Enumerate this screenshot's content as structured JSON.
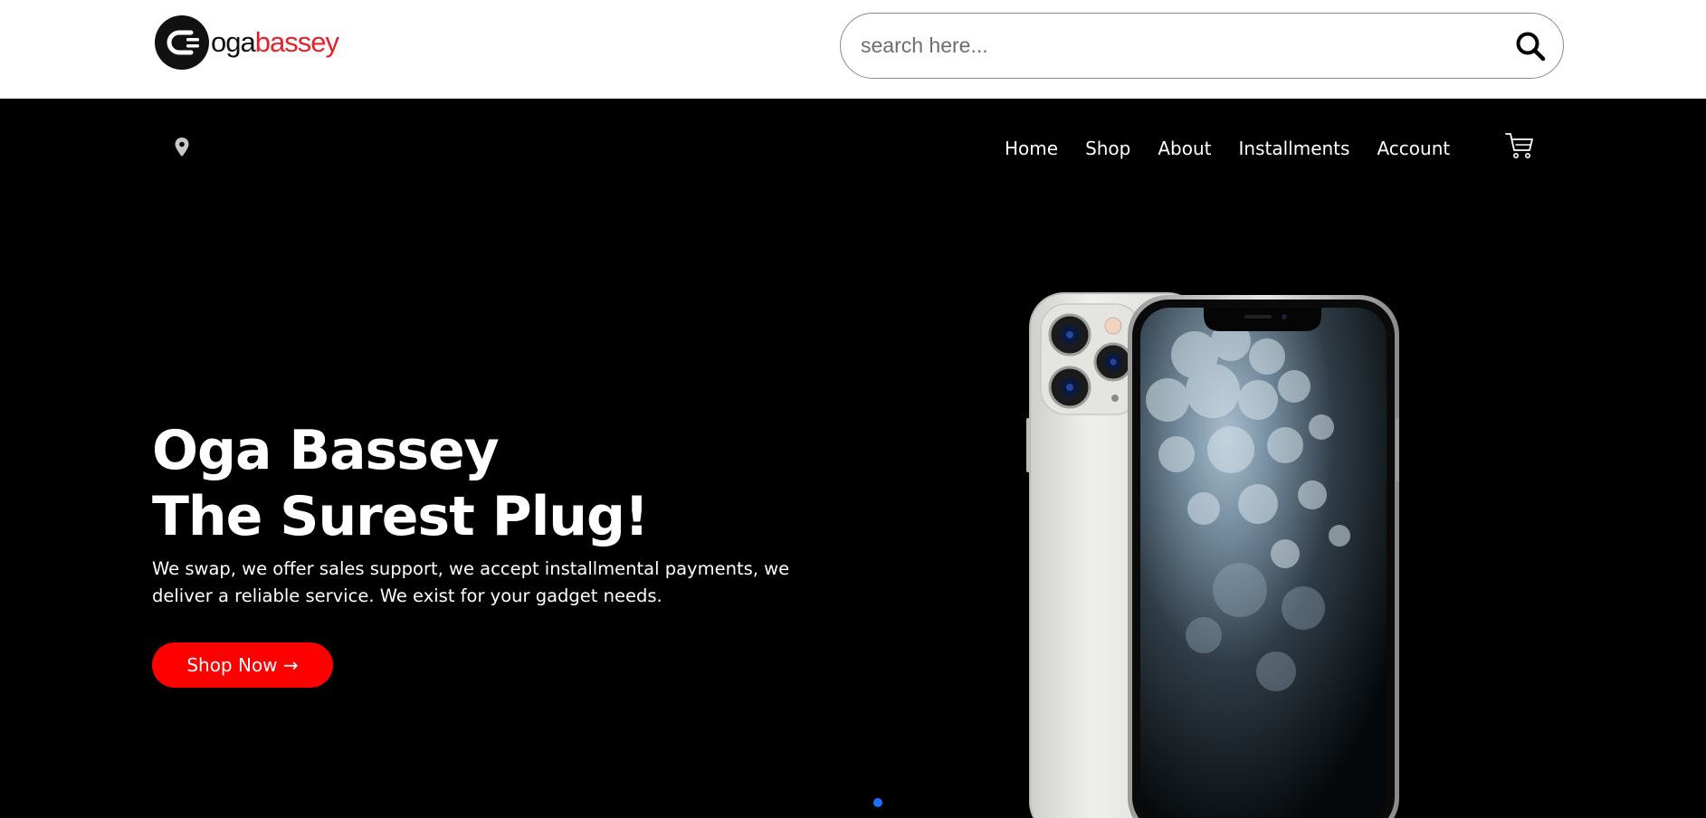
{
  "brand": {
    "logo_text_dark": "oga",
    "logo_text_accent": "bassey",
    "logo_icon": "plug-logo-icon",
    "accent_color": "#e8202a"
  },
  "search": {
    "placeholder": "search here...",
    "value": "",
    "icon": "search-icon"
  },
  "nav": {
    "location_icon": "map-pin-icon",
    "items": [
      {
        "label": "Home"
      },
      {
        "label": "Shop"
      },
      {
        "label": "About"
      },
      {
        "label": "Installments"
      },
      {
        "label": "Account"
      }
    ],
    "cart_icon": "cart-icon"
  },
  "hero": {
    "title_line1": "Oga Bassey",
    "title_line2": "The Surest Plug!",
    "description": "We swap, we offer sales support, we accept installmental payments, we deliver a reliable service. We exist for your gadget needs.",
    "cta_label": "Shop Now →",
    "cta_color": "#ff0000",
    "image": "smartphone-product-image"
  },
  "carousel": {
    "active_dot_color": "#1e6fff"
  },
  "colors": {
    "header_bg": "#ffffff",
    "page_bg": "#000000",
    "text_light": "#ffffff"
  }
}
